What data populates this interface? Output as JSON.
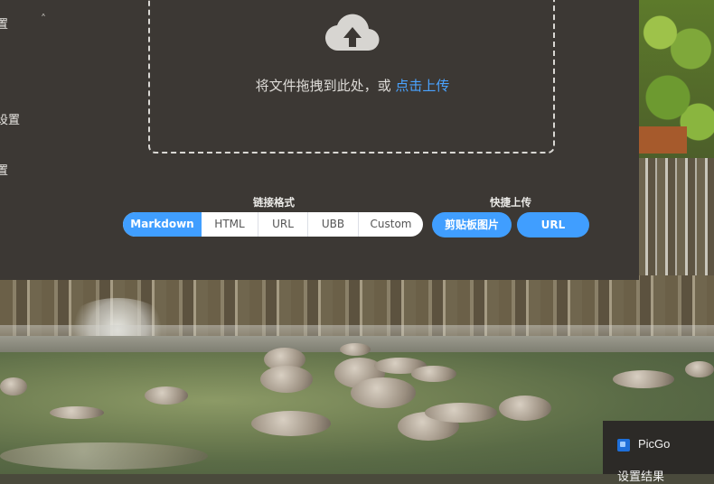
{
  "sidebar": {
    "items": [
      {
        "label": "置"
      },
      {
        "label": "设置"
      },
      {
        "label": "置"
      }
    ],
    "expand_icon": "chevron-up-icon"
  },
  "upload": {
    "icon": "cloud-upload-icon",
    "prompt": "将文件拖拽到此处，或",
    "link": "点击上传"
  },
  "link_format": {
    "title": "链接格式",
    "options": [
      "Markdown",
      "HTML",
      "URL",
      "UBB",
      "Custom"
    ],
    "selected": "Markdown"
  },
  "quick_upload": {
    "title": "快捷上传",
    "clipboard_label": "剪贴板图片",
    "url_label": "URL"
  },
  "tray": {
    "app_name": "PicGo",
    "menu_item": "设置结果"
  },
  "colors": {
    "accent": "#409eff",
    "panel": "#3c3834",
    "link": "#4aa3ff"
  }
}
